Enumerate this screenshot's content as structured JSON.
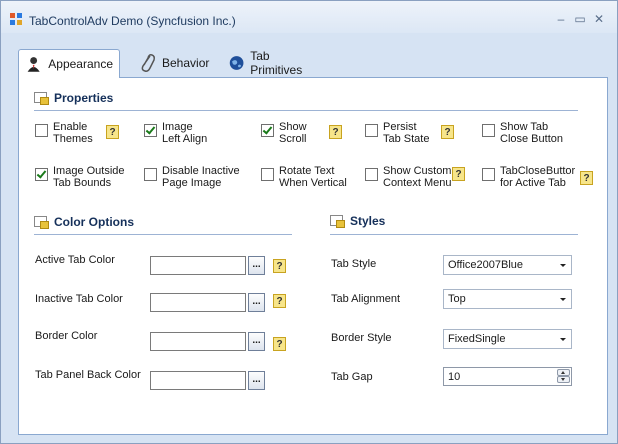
{
  "window": {
    "title": "TabControlAdv Demo (Syncfusion Inc.)",
    "controls": {
      "minimize": "–",
      "maximize": "▭",
      "close": "✕"
    }
  },
  "tabs": [
    {
      "label": "Appearance",
      "icon": "user-icon",
      "active": true
    },
    {
      "label": "Behavior",
      "icon": "paperclip-icon",
      "active": false
    },
    {
      "label": "Tab Primitives",
      "icon": "globe-icon",
      "active": false
    }
  ],
  "properties": {
    "heading": "Properties",
    "options": [
      {
        "label": "Enable\nThemes",
        "checked": false,
        "help": true
      },
      {
        "label": "Image\nLeft Align",
        "checked": true,
        "help": false
      },
      {
        "label": "Show\nScroll",
        "checked": true,
        "help": true
      },
      {
        "label": "Persist\nTab State",
        "checked": false,
        "help": true
      },
      {
        "label": "Show Tab\nClose Button",
        "checked": false,
        "help": false
      },
      {
        "label": "Image  Outside\nTab Bounds",
        "checked": true,
        "help": false
      },
      {
        "label": "Disable  Inactive\nPage Image",
        "checked": false,
        "help": false
      },
      {
        "label": "Rotate  Text\nWhen Vertical",
        "checked": false,
        "help": false
      },
      {
        "label": "Show  Custom\nContext Menu",
        "checked": false,
        "help": true
      },
      {
        "label": "TabCloseButtor\nfor Active Tab",
        "checked": false,
        "help": true
      }
    ]
  },
  "color_options": {
    "heading": "Color Options",
    "browse_label": "...",
    "help_label": "?",
    "fields": [
      {
        "label": "Active Tab Color",
        "value": "",
        "help": true
      },
      {
        "label": "Inactive Tab Color",
        "value": "",
        "help": true
      },
      {
        "label": "Border Color",
        "value": "",
        "help": true
      },
      {
        "label": "Tab Panel Back Color",
        "value": "",
        "help": false
      }
    ]
  },
  "styles": {
    "heading": "Styles",
    "tab_style": {
      "label": "Tab Style",
      "value": "Office2007Blue"
    },
    "tab_alignment": {
      "label": "Tab Alignment",
      "value": "Top"
    },
    "border_style": {
      "label": "Border Style",
      "value": "FixedSingle"
    },
    "tab_gap": {
      "label": "Tab Gap",
      "value": "10"
    }
  },
  "colors": {
    "accent": "#15305a",
    "title_text": "#1f3b60",
    "window_bg": "#d6e3f3",
    "help_bg": "#f7e58a"
  }
}
